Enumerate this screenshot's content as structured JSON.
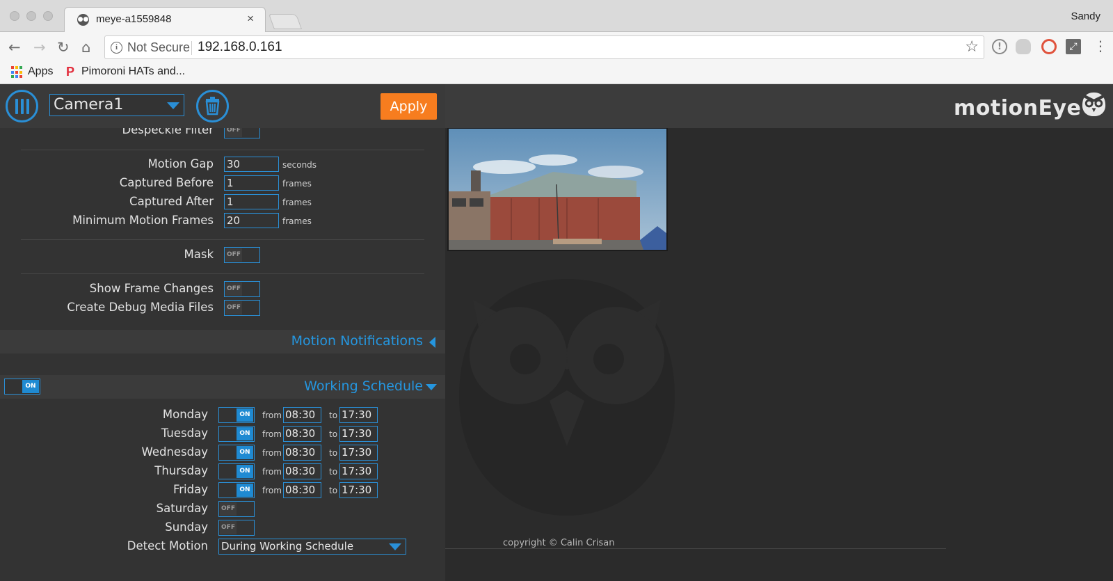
{
  "browser": {
    "tab_title": "meye-a1559848",
    "tab_close": "×",
    "user": "Sandy",
    "security_label": "Not Secure",
    "url": "192.168.0.161",
    "nav": {
      "back": "←",
      "forward": "→",
      "reload": "↻",
      "home": "⌂"
    },
    "star": "☆",
    "menu": "⋮",
    "bookmarks": [
      {
        "label": "Apps",
        "icon": "apps-grid-icon"
      },
      {
        "label": "Pimoroni HATs and...",
        "icon": "pimoroni-icon"
      }
    ],
    "colors": {
      "apps_grid": [
        "#ea4335",
        "#fbbc05",
        "#34a853",
        "#4285f4",
        "#ea4335",
        "#fbbc05",
        "#34a853",
        "#4285f4",
        "#ea4335"
      ]
    }
  },
  "header": {
    "camera_selected": "Camera1",
    "apply_label": "Apply",
    "brand": "motionEye"
  },
  "settings": {
    "despeckle_filter": {
      "label": "Despeckle Filter",
      "state": "OFF"
    },
    "motion_gap": {
      "label": "Motion Gap",
      "value": "30",
      "unit": "seconds"
    },
    "captured_before": {
      "label": "Captured Before",
      "value": "1",
      "unit": "frames"
    },
    "captured_after": {
      "label": "Captured After",
      "value": "1",
      "unit": "frames"
    },
    "min_motion_frames": {
      "label": "Minimum Motion Frames",
      "value": "20",
      "unit": "frames"
    },
    "mask": {
      "label": "Mask",
      "state": "OFF"
    },
    "show_frame_changes": {
      "label": "Show Frame Changes",
      "state": "OFF"
    },
    "create_debug_media": {
      "label": "Create Debug Media Files",
      "state": "OFF"
    }
  },
  "sections": {
    "motion_notifications": "Motion Notifications",
    "working_schedule": "Working Schedule",
    "working_schedule_state": "ON"
  },
  "schedule": {
    "from_label": "from",
    "to_label": "to",
    "days": [
      {
        "day": "Monday",
        "state": "ON",
        "from": "08:30",
        "to": "17:30"
      },
      {
        "day": "Tuesday",
        "state": "ON",
        "from": "08:30",
        "to": "17:30"
      },
      {
        "day": "Wednesday",
        "state": "ON",
        "from": "08:30",
        "to": "17:30"
      },
      {
        "day": "Thursday",
        "state": "ON",
        "from": "08:30",
        "to": "17:30"
      },
      {
        "day": "Friday",
        "state": "ON",
        "from": "08:30",
        "to": "17:30"
      },
      {
        "day": "Saturday",
        "state": "OFF"
      },
      {
        "day": "Sunday",
        "state": "OFF"
      }
    ],
    "detect_motion_label": "Detect Motion",
    "detect_motion_value": "During Working Schedule"
  },
  "footer": {
    "copyright": "copyright © Calin Crisan"
  },
  "theme": {
    "accent": "#2a8fd6",
    "apply": "#f77d1f",
    "panel": "#333333",
    "background": "#2b2b2b"
  }
}
